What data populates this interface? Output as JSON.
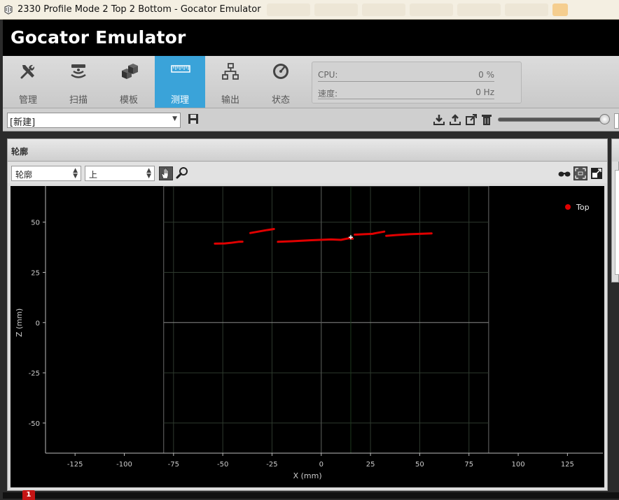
{
  "window": {
    "title": "2330 Profile Mode 2 Top 2 Bottom - Gocator Emulator"
  },
  "app": {
    "brand": "Gocator Emulator"
  },
  "nav": [
    {
      "label": "管理",
      "icon": "tools-icon",
      "active": false
    },
    {
      "label": "扫描",
      "icon": "scan-icon",
      "active": false
    },
    {
      "label": "模板",
      "icon": "model-icon",
      "active": false
    },
    {
      "label": "测理",
      "icon": "ruler-icon",
      "active": true
    },
    {
      "label": "输出",
      "icon": "network-icon",
      "active": false
    },
    {
      "label": "状态",
      "icon": "gauge-icon",
      "active": false
    }
  ],
  "stats": {
    "cpu_label": "CPU:",
    "cpu_value": "0 %",
    "speed_label": "速度:",
    "speed_value": "0 Hz"
  },
  "job": {
    "selected": "[新建]"
  },
  "panel": {
    "title": "轮廓",
    "view_select": "轮廓",
    "side_select": "上"
  },
  "chart_data": {
    "type": "scatter",
    "xlabel": "X (mm)",
    "ylabel": "Z (mm)",
    "xlim": [
      -140,
      143
    ],
    "ylim": [
      -65,
      68
    ],
    "xticks": [
      -125,
      -100,
      -75,
      -50,
      -25,
      0,
      25,
      50,
      75,
      100,
      125
    ],
    "yticks": [
      50,
      25,
      0,
      -25,
      -50
    ],
    "legend_position": "top-right",
    "series": [
      {
        "name": "Top",
        "color": "#e00000",
        "segments": [
          [
            [
              -54,
              39.3
            ],
            [
              -49,
              39.4
            ],
            [
              -46,
              39.7
            ],
            [
              -42,
              40.2
            ],
            [
              -40,
              40.3
            ]
          ],
          [
            [
              -36,
              44.6
            ],
            [
              -32,
              45.3
            ],
            [
              -28,
              46.0
            ],
            [
              -24,
              46.6
            ]
          ],
          [
            [
              -22,
              40.2
            ],
            [
              -15,
              40.5
            ],
            [
              -5,
              41.0
            ],
            [
              5,
              41.4
            ],
            [
              10,
              41.2
            ],
            [
              14,
              42.0
            ],
            [
              16,
              41.8
            ]
          ],
          [
            [
              17,
              43.8
            ],
            [
              22,
              44.0
            ],
            [
              26,
              44.2
            ],
            [
              28,
              44.6
            ],
            [
              32,
              45.3
            ]
          ],
          [
            [
              33,
              43.2
            ],
            [
              38,
              43.6
            ],
            [
              45,
              44.0
            ],
            [
              50,
              44.2
            ],
            [
              56,
              44.4
            ]
          ]
        ]
      }
    ],
    "cursor_marker": {
      "x": 15,
      "z": 42.5
    }
  }
}
